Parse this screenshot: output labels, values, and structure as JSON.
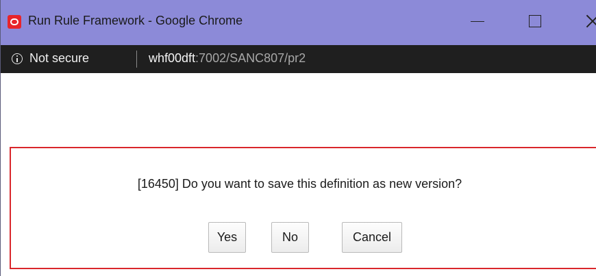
{
  "window": {
    "title": "Run Rule Framework - Google Chrome",
    "icon": "oracle-logo-icon",
    "controls": [
      "minimize-icon",
      "maximize-icon",
      "close-icon"
    ]
  },
  "address_bar": {
    "security_icon": "info-icon",
    "security_label": "Not secure",
    "url_host": "whf00dft",
    "url_rest": ":7002/SANC807/pr2"
  },
  "dialog": {
    "message": "[16450] Do you want to save this definition as new version?",
    "buttons": {
      "yes": "Yes",
      "no": "No",
      "cancel": "Cancel"
    }
  },
  "colors": {
    "titlebar": "#8c8ad8",
    "addressbar": "#1f1f1f",
    "dialog_border": "#d9262b",
    "icon_red": "#e8242a"
  }
}
